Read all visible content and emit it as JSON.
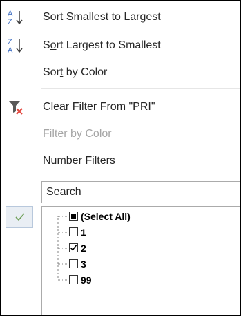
{
  "menu": {
    "sort_asc": {
      "pre": "",
      "key": "S",
      "post": "ort Smallest to Largest"
    },
    "sort_desc": {
      "pre": "S",
      "key": "o",
      "post": "rt Largest to Smallest"
    },
    "sort_color": {
      "pre": "Sor",
      "key": "t",
      "post": " by Color"
    },
    "clear_filter": {
      "pre": "",
      "key": "C",
      "post": "lear Filter From \"PRI\""
    },
    "filter_color": {
      "pre": "F",
      "key": "i",
      "post": "lter by Color"
    },
    "number_filters": {
      "pre": "Number ",
      "key": "F",
      "post": "ilters"
    }
  },
  "search": {
    "placeholder": "Search"
  },
  "list": {
    "items": [
      {
        "label": "(Select All)",
        "state": "partial"
      },
      {
        "label": "1",
        "state": "unchecked"
      },
      {
        "label": "2",
        "state": "checked"
      },
      {
        "label": "3",
        "state": "unchecked"
      },
      {
        "label": "99",
        "state": "unchecked"
      }
    ]
  },
  "colors": {
    "icon_blue": "#4472c4",
    "clear_red": "#e2453c",
    "check_green": "#6fa05a"
  },
  "icons": {
    "sort_asc": "sort-ascending-icon",
    "sort_desc": "sort-descending-icon",
    "clear_filter": "clear-filter-icon",
    "ok_check": "checkmark-icon"
  }
}
